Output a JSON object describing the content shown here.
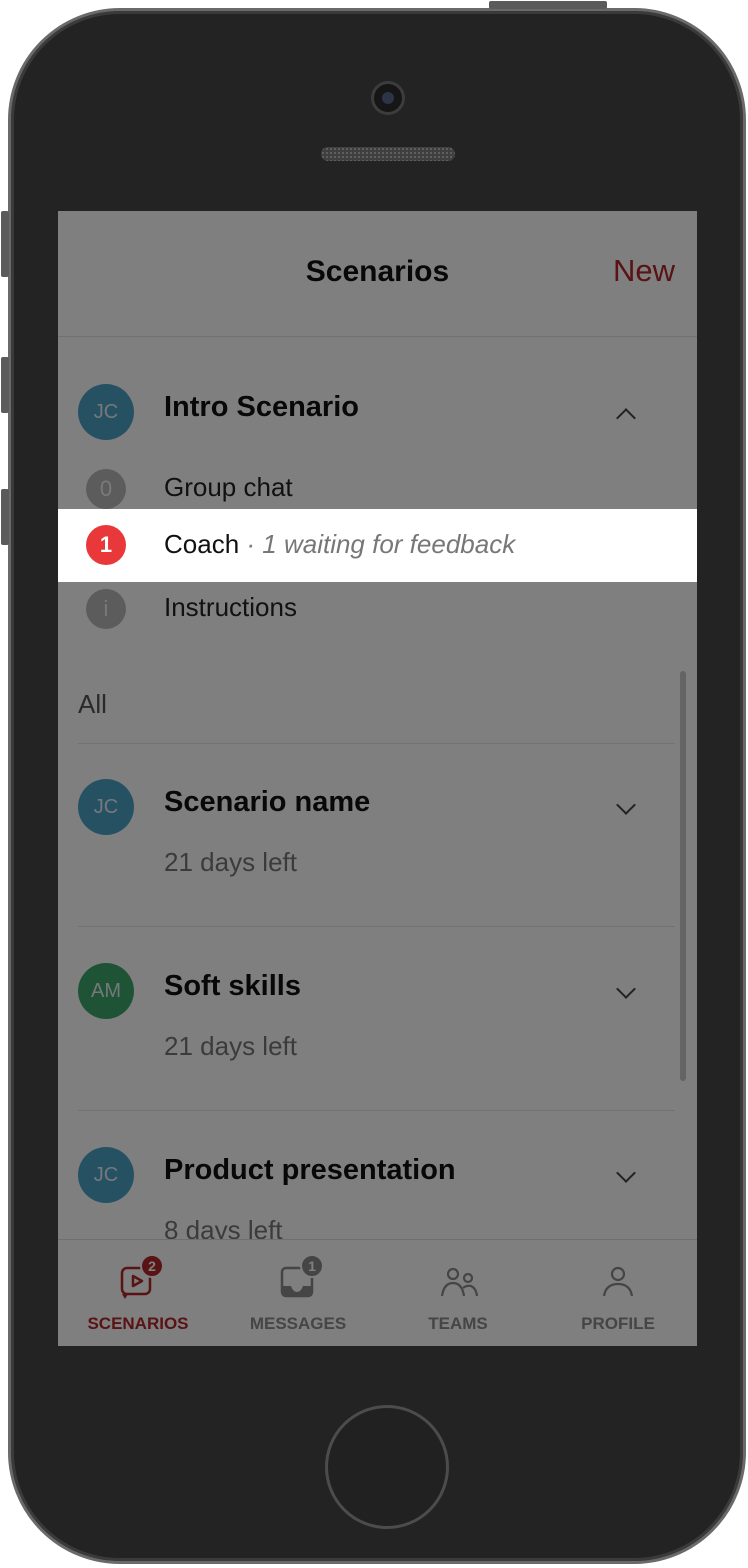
{
  "nav": {
    "title": "Scenarios",
    "new_label": "New"
  },
  "expanded": {
    "avatar": "JC",
    "title": "Intro Scenario",
    "items": [
      {
        "badge": "0",
        "label": "Group chat"
      },
      {
        "badge": "1",
        "label": "Coach",
        "hint": "· 1 waiting for feedback"
      },
      {
        "badge": "i",
        "label": "Instructions"
      }
    ]
  },
  "section_label": "All",
  "scenarios": [
    {
      "avatar": "JC",
      "title": "Scenario name",
      "sub": "21 days left",
      "color": "#4aa3c6"
    },
    {
      "avatar": "AM",
      "title": "Soft skills",
      "sub": "21 days left",
      "color": "#3da86a"
    },
    {
      "avatar": "JC",
      "title": "Product presentation",
      "sub": "8 days left",
      "color": "#4aa3c6"
    }
  ],
  "tabs": [
    {
      "label": "SCENARIOS",
      "badge": "2",
      "icon": "scenarios-icon",
      "active": true
    },
    {
      "label": "MESSAGES",
      "badge": "1",
      "icon": "inbox-icon",
      "active": false
    },
    {
      "label": "TEAMS",
      "icon": "teams-icon",
      "active": false
    },
    {
      "label": "PROFILE",
      "icon": "profile-icon",
      "active": false
    }
  ],
  "colors": {
    "accent": "#b3262a",
    "avatar_blue": "#4aa3c6",
    "avatar_green": "#3da86a",
    "badge_red": "#e8383a"
  }
}
